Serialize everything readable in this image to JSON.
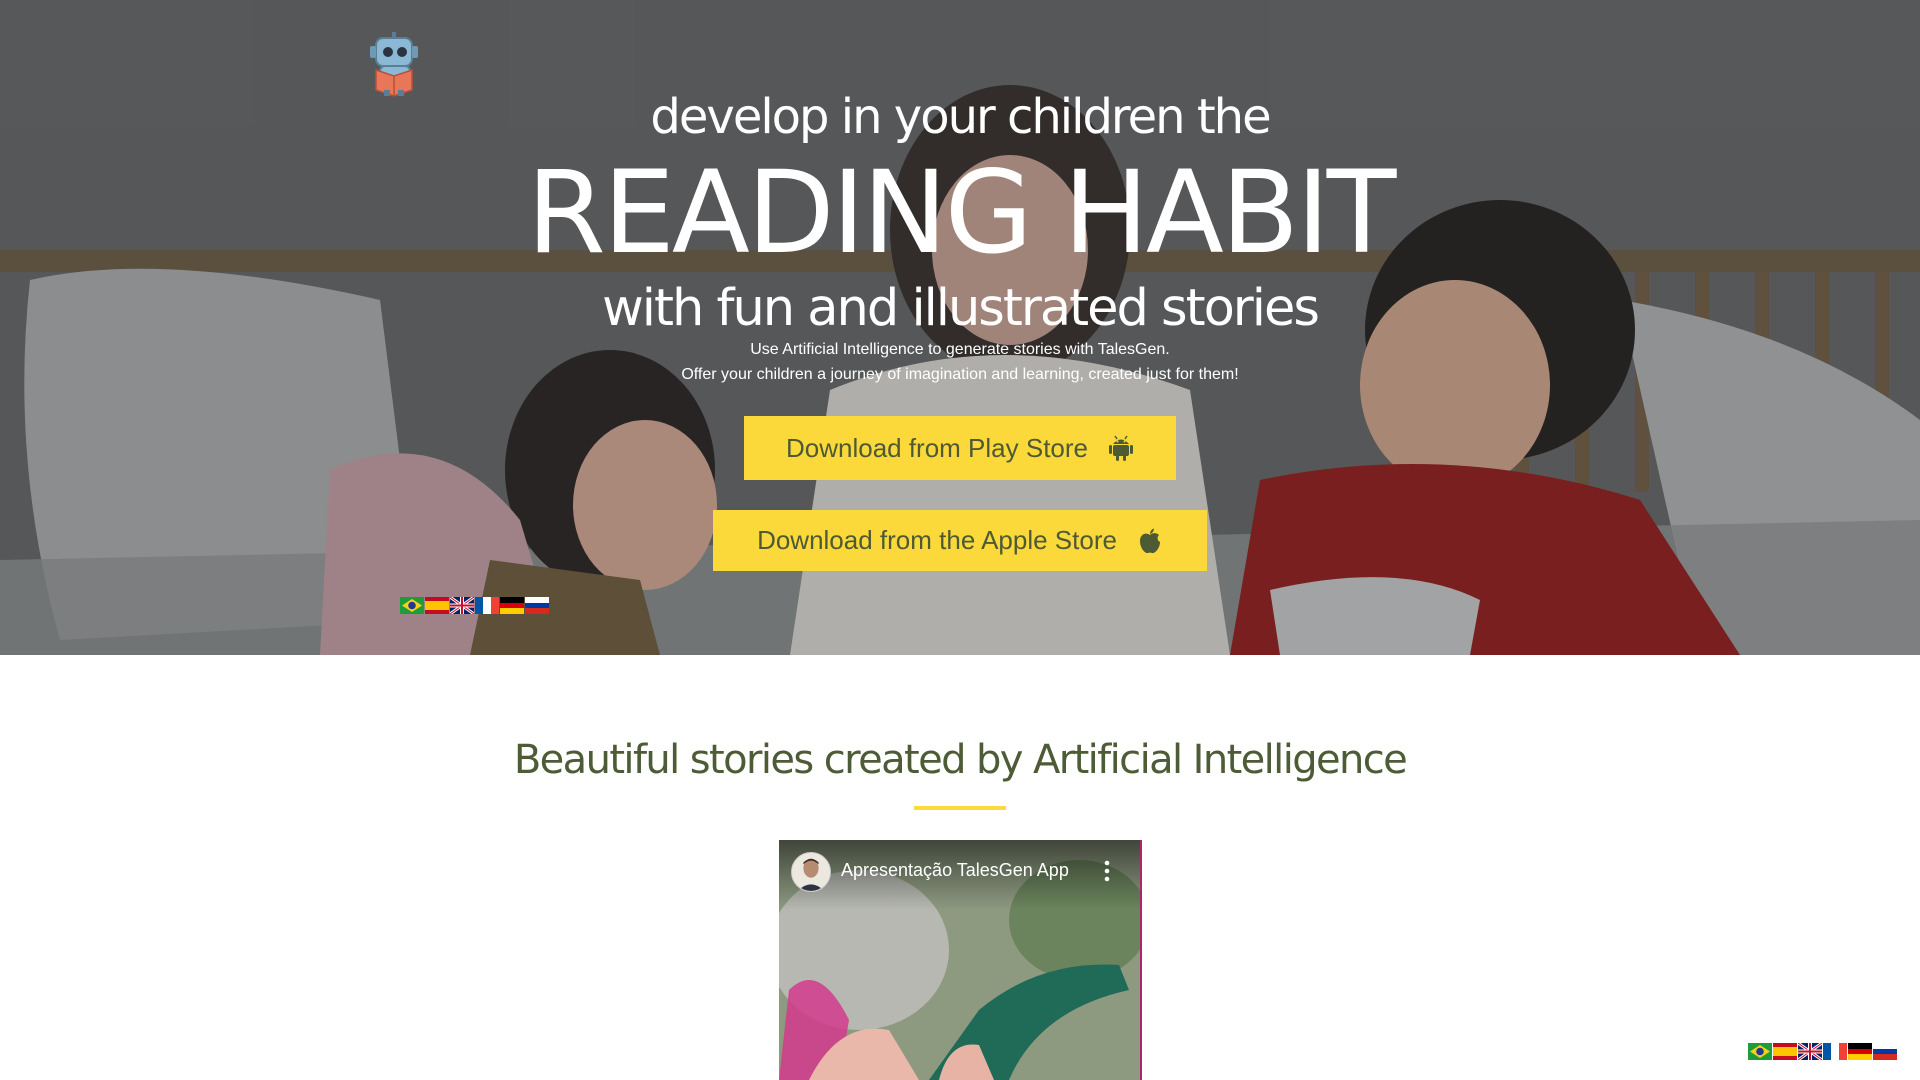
{
  "hero": {
    "kicker": "develop in your children the",
    "headline": "READING HABIT",
    "subhead": "with fun and illustrated stories",
    "tagline_line1": "Use Artificial Intelligence to generate stories with TalesGen.",
    "tagline_line2": "Offer your children a journey of imagination and learning, created just for them!",
    "play_store_label": "Download from Play Store",
    "apple_store_label": "Download from the Apple Store",
    "play_icon": "android-icon",
    "apple_icon": "apple-icon"
  },
  "languages": [
    "pt-BR",
    "es",
    "en-GB",
    "fr",
    "de",
    "ru"
  ],
  "section": {
    "title": "Beautiful stories created by Artificial Intelligence"
  },
  "video": {
    "title": "Apresentação TalesGen App"
  },
  "colors": {
    "accent": "#fbd93a",
    "button_text": "#4e5a34",
    "section_title": "#4d5c36"
  }
}
